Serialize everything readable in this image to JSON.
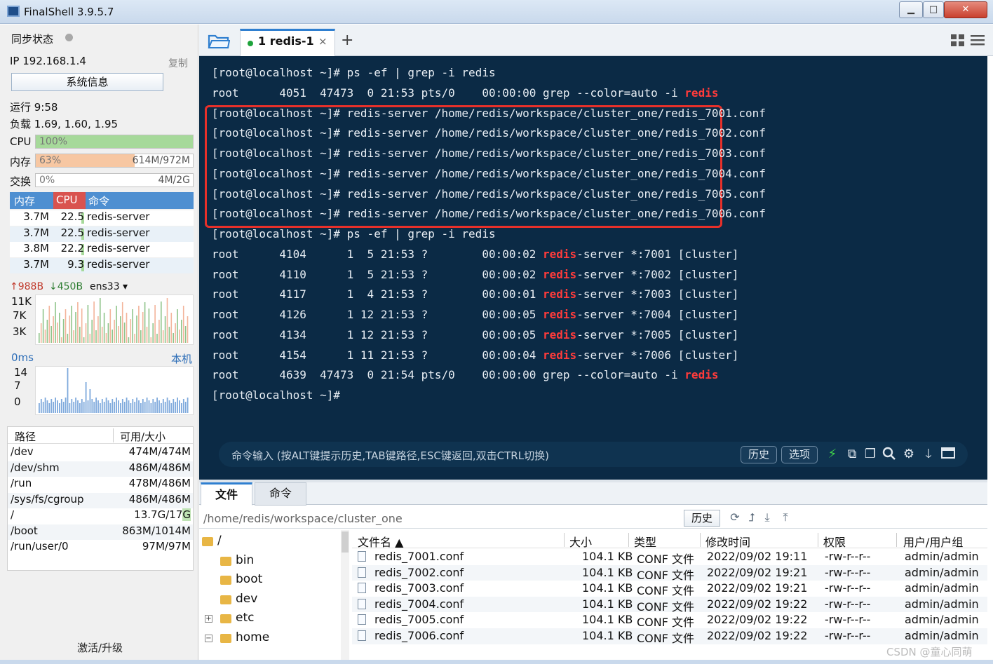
{
  "window": {
    "title": "FinalShell 3.9.5.7",
    "min_label": "▁",
    "max_label": "□",
    "close_label": "✕"
  },
  "sidebar": {
    "sync_label": "同步状态",
    "ip": "IP 192.168.1.4",
    "copy_label": "复制",
    "sysinfo_label": "系统信息",
    "uptime": "运行 9:58",
    "load": "负载 1.69, 1.60, 1.95",
    "cpu": {
      "label": "CPU",
      "percent": "100%",
      "fill": 1.0
    },
    "memory": {
      "label": "内存",
      "percent": "63%",
      "usage": "614M/972M",
      "fill": 0.63
    },
    "swap": {
      "label": "交换",
      "percent": "0%",
      "usage": "4M/2G",
      "fill": 0.0
    },
    "process_columns": [
      "内存",
      "CPU",
      "命令"
    ],
    "processes": [
      {
        "mem": "3.7M",
        "cpu": "22.5",
        "cmd": "redis-server"
      },
      {
        "mem": "3.7M",
        "cpu": "22.5",
        "cmd": "redis-server"
      },
      {
        "mem": "3.8M",
        "cpu": "22.2",
        "cmd": "redis-server"
      },
      {
        "mem": "3.7M",
        "cpu": "9.3",
        "cmd": "redis-server"
      }
    ],
    "net": {
      "up": "↑988B",
      "down": "↓450B",
      "iface": "ens33 ▾",
      "ticks": [
        "11K",
        "7K",
        "3K"
      ]
    },
    "ping": {
      "label": "0ms",
      "host": "本机",
      "ticks": [
        "14",
        "7",
        "0"
      ]
    },
    "disk_columns": [
      "路径",
      "可用/大小"
    ],
    "disks": [
      {
        "path": "/dev",
        "size": "474M/474M"
      },
      {
        "path": "/dev/shm",
        "size": "486M/486M"
      },
      {
        "path": "/run",
        "size": "478M/486M"
      },
      {
        "path": "/sys/fs/cgroup",
        "size": "486M/486M"
      },
      {
        "path": "/",
        "size": "13.7G/17G"
      },
      {
        "path": "/boot",
        "size": "863M/1014M"
      },
      {
        "path": "/run/user/0",
        "size": "97M/97M"
      }
    ],
    "upgrade_label": "激活/升级"
  },
  "tabs": {
    "active_label": "1 redis-1",
    "close": "×",
    "add": "+"
  },
  "terminal": {
    "lines": [
      [
        {
          "t": "[root@localhost ~]# ps -ef | grep -i redis"
        }
      ],
      [
        {
          "t": "root      4051  47473  0 21:53 pts/0    00:00:00 grep --color=auto -i "
        },
        {
          "t": "redis",
          "h": true
        }
      ],
      [
        {
          "t": "[root@localhost ~]# redis-server /home/redis/workspace/cluster_one/redis_7001.conf"
        }
      ],
      [
        {
          "t": "[root@localhost ~]# redis-server /home/redis/workspace/cluster_one/redis_7002.conf"
        }
      ],
      [
        {
          "t": "[root@localhost ~]# redis-server /home/redis/workspace/cluster_one/redis_7003.conf"
        }
      ],
      [
        {
          "t": "[root@localhost ~]# redis-server /home/redis/workspace/cluster_one/redis_7004.conf"
        }
      ],
      [
        {
          "t": "[root@localhost ~]# redis-server /home/redis/workspace/cluster_one/redis_7005.conf"
        }
      ],
      [
        {
          "t": "[root@localhost ~]# redis-server /home/redis/workspace/cluster_one/redis_7006.conf"
        }
      ],
      [
        {
          "t": "[root@localhost ~]# ps -ef | grep -i redis"
        }
      ],
      [
        {
          "t": "root      4104      1  5 21:53 ?        00:00:02 "
        },
        {
          "t": "redis",
          "h": true
        },
        {
          "t": "-server *:7001 [cluster]"
        }
      ],
      [
        {
          "t": "root      4110      1  5 21:53 ?        00:00:02 "
        },
        {
          "t": "redis",
          "h": true
        },
        {
          "t": "-server *:7002 [cluster]"
        }
      ],
      [
        {
          "t": "root      4117      1  4 21:53 ?        00:00:01 "
        },
        {
          "t": "redis",
          "h": true
        },
        {
          "t": "-server *:7003 [cluster]"
        }
      ],
      [
        {
          "t": "root      4126      1 12 21:53 ?        00:00:05 "
        },
        {
          "t": "redis",
          "h": true
        },
        {
          "t": "-server *:7004 [cluster]"
        }
      ],
      [
        {
          "t": "root      4134      1 12 21:53 ?        00:00:05 "
        },
        {
          "t": "redis",
          "h": true
        },
        {
          "t": "-server *:7005 [cluster]"
        }
      ],
      [
        {
          "t": "root      4154      1 11 21:53 ?        00:00:04 "
        },
        {
          "t": "redis",
          "h": true
        },
        {
          "t": "-server *:7006 [cluster]"
        }
      ],
      [
        {
          "t": "root      4639  47473  0 21:54 pts/0    00:00:00 grep --color=auto -i "
        },
        {
          "t": "redis",
          "h": true
        }
      ],
      [
        {
          "t": "[root@localhost ~]#"
        }
      ]
    ],
    "cmd_hint": "命令输入 (按ALT键提示历史,TAB键路径,ESC键返回,双击CTRL切换)",
    "history_label": "历史",
    "options_label": "选项"
  },
  "files": {
    "tab_files": "文件",
    "tab_cmd": "命令",
    "path": "/home/redis/workspace/cluster_one",
    "history_label": "历史",
    "tree": [
      {
        "name": "/",
        "level": 0
      },
      {
        "name": "bin",
        "level": 1
      },
      {
        "name": "boot",
        "level": 1
      },
      {
        "name": "dev",
        "level": 1
      },
      {
        "name": "etc",
        "level": 1,
        "exp": "+"
      },
      {
        "name": "home",
        "level": 1,
        "exp": "−"
      }
    ],
    "columns": [
      "文件名 ▲",
      "大小",
      "类型",
      "修改时间",
      "权限",
      "用户/用户组"
    ],
    "rows": [
      {
        "name": "redis_7001.conf",
        "size": "104.1 KB",
        "type": "CONF 文件",
        "mtime": "2022/09/02 19:11",
        "perm": "-rw-r--r--",
        "owner": "admin/admin"
      },
      {
        "name": "redis_7002.conf",
        "size": "104.1 KB",
        "type": "CONF 文件",
        "mtime": "2022/09/02 19:21",
        "perm": "-rw-r--r--",
        "owner": "admin/admin"
      },
      {
        "name": "redis_7003.conf",
        "size": "104.1 KB",
        "type": "CONF 文件",
        "mtime": "2022/09/02 19:21",
        "perm": "-rw-r--r--",
        "owner": "admin/admin"
      },
      {
        "name": "redis_7004.conf",
        "size": "104.1 KB",
        "type": "CONF 文件",
        "mtime": "2022/09/02 19:22",
        "perm": "-rw-r--r--",
        "owner": "admin/admin"
      },
      {
        "name": "redis_7005.conf",
        "size": "104.1 KB",
        "type": "CONF 文件",
        "mtime": "2022/09/02 19:22",
        "perm": "-rw-r--r--",
        "owner": "admin/admin"
      },
      {
        "name": "redis_7006.conf",
        "size": "104.1 KB",
        "type": "CONF 文件",
        "mtime": "2022/09/02 19:22",
        "perm": "-rw-r--r--",
        "owner": "admin/admin"
      }
    ]
  },
  "watermark": "CSDN @童心同萌",
  "colors": {
    "terminal_bg": "#0b2a45",
    "highlight": "#ff3b3b",
    "accent": "#2f7fd0",
    "cpu_fill": "#a6d99a",
    "mem_fill": "#f7c7a2"
  }
}
